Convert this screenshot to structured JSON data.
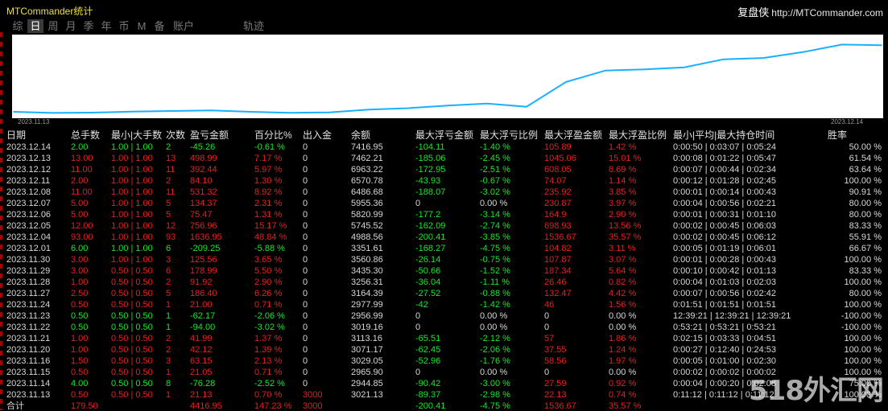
{
  "app_title": "MTCommander统计",
  "brand": "复盘侠",
  "site_url": "http://MTCommander.com",
  "tabs": [
    {
      "label": "综",
      "active": false
    },
    {
      "label": "日",
      "active": true
    },
    {
      "label": "周",
      "active": false
    },
    {
      "label": "月",
      "active": false
    },
    {
      "label": "季",
      "active": false
    },
    {
      "label": "年",
      "active": false
    },
    {
      "label": "币",
      "active": false
    },
    {
      "label": "M",
      "active": false
    },
    {
      "label": "备",
      "active": false
    },
    {
      "label": "账户",
      "active": false
    },
    {
      "label": "轨迹",
      "active": false
    }
  ],
  "chart_data": {
    "type": "line",
    "series_color": "#1ab0ff",
    "x_start_label": "2023.11.13",
    "x_end_label": "2023.12.14",
    "x": [
      "2023.11.13",
      "2023.11.14",
      "2023.11.15",
      "2023.11.16",
      "2023.11.20",
      "2023.11.21",
      "2023.11.22",
      "2023.11.23",
      "2023.11.24",
      "2023.11.27",
      "2023.11.28",
      "2023.11.29",
      "2023.11.30",
      "2023.12.01",
      "2023.12.04",
      "2023.12.05",
      "2023.12.06",
      "2023.12.07",
      "2023.12.08",
      "2023.12.11",
      "2023.12.12",
      "2023.12.13",
      "2023.12.14"
    ],
    "y": [
      3021.13,
      2944.85,
      2965.9,
      3029.05,
      3071.17,
      3113.16,
      3019.16,
      2956.99,
      2977.99,
      3164.39,
      3256.31,
      3435.3,
      3560.86,
      3351.61,
      4988.56,
      5745.52,
      5820.99,
      5955.36,
      6486.68,
      6570.78,
      6963.22,
      7462.21,
      7416.95
    ]
  },
  "columns": [
    "日期",
    "总手数",
    "最小|大手数",
    "次数",
    "盈亏金额",
    "百分比%",
    "出入金",
    "余额",
    "最大浮亏金额",
    "最大浮亏比例",
    "最大浮盈金额",
    "最大浮盈比例",
    "最小|平均|最大持仓时间",
    "胜率"
  ],
  "rows": [
    [
      "2023.12.14",
      "2.00",
      "1.00 | 1.00",
      "2",
      "-45.26",
      "-0.61 %",
      "0",
      "7416.95",
      "-104.11",
      "-1.40 %",
      "105.89",
      "1.42 %",
      "0:00:50 | 0:03:07 | 0:05:24",
      "50.00 %"
    ],
    [
      "2023.12.13",
      "13.00",
      "1.00 | 1.00",
      "13",
      "498.99",
      "7.17 %",
      "0",
      "7462.21",
      "-185.06",
      "-2.45 %",
      "1045.06",
      "15.01 %",
      "0:00:08 | 0:01:22 | 0:05:47",
      "61.54 %"
    ],
    [
      "2023.12.12",
      "11.00",
      "1.00 | 1.00",
      "11",
      "392.44",
      "5.97 %",
      "0",
      "6963.22",
      "-172.95",
      "-2.51 %",
      "608.05",
      "8.69 %",
      "0:00:07 | 0:00:44 | 0:02:34",
      "63.64 %"
    ],
    [
      "2023.12.11",
      "2.00",
      "1.00 | 1.00",
      "2",
      "84.10",
      "1.30 %",
      "0",
      "6570.78",
      "-43.93",
      "-0.67 %",
      "74.07",
      "1.14 %",
      "0:00:12 | 0:01:28 | 0:02:45",
      "100.00 %"
    ],
    [
      "2023.12.08",
      "11.00",
      "1.00 | 1.00",
      "11",
      "531.32",
      "8.92 %",
      "0",
      "6486.68",
      "-188.07",
      "-3.02 %",
      "235.92",
      "3.85 %",
      "0:00:01 | 0:00:14 | 0:00:43",
      "90.91 %"
    ],
    [
      "2023.12.07",
      "5.00",
      "1.00 | 1.00",
      "5",
      "134.37",
      "2.31 %",
      "0",
      "5955.36",
      "0",
      "0.00 %",
      "230.87",
      "3.97 %",
      "0:00:04 | 0:00:56 | 0:02:21",
      "80.00 %"
    ],
    [
      "2023.12.06",
      "5.00",
      "1.00 | 1.00",
      "5",
      "75.47",
      "1.31 %",
      "0",
      "5820.99",
      "-177.2",
      "-3.14 %",
      "164.9",
      "2.90 %",
      "0:00:01 | 0:00:31 | 0:01:10",
      "80.00 %"
    ],
    [
      "2023.12.05",
      "12.00",
      "1.00 | 1.00",
      "12",
      "756.96",
      "15.17 %",
      "0",
      "5745.52",
      "-162.09",
      "-2.74 %",
      "698.93",
      "13.56 %",
      "0:00:02 | 0:00:45 | 0:06:03",
      "83.33 %"
    ],
    [
      "2023.12.04",
      "93.00",
      "1.00 | 1.00",
      "93",
      "1636.95",
      "48.84 %",
      "0",
      "4988.56",
      "-200.41",
      "-3.85 %",
      "1536.67",
      "35.57 %",
      "0:00:02 | 0:00:45 | 0:06:12",
      "55.91 %"
    ],
    [
      "2023.12.01",
      "6.00",
      "1.00 | 1.00",
      "6",
      "-209.25",
      "-5.88 %",
      "0",
      "3351.61",
      "-168.27",
      "-4.75 %",
      "104.82",
      "3.11 %",
      "0:00:05 | 0:01:19 | 0:06:01",
      "66.67 %"
    ],
    [
      "2023.11.30",
      "3.00",
      "1.00 | 1.00",
      "3",
      "125.56",
      "3.65 %",
      "0",
      "3560.86",
      "-26.14",
      "-0.75 %",
      "107.87",
      "3.07 %",
      "0:00:01 | 0:00:28 | 0:00:43",
      "100.00 %"
    ],
    [
      "2023.11.29",
      "3.00",
      "0.50 | 0.50",
      "6",
      "178.99",
      "5.50 %",
      "0",
      "3435.30",
      "-50.66",
      "-1.52 %",
      "187.34",
      "5.64 %",
      "0:00:10 | 0:00:42 | 0:01:13",
      "83.33 %"
    ],
    [
      "2023.11.28",
      "1.00",
      "0.50 | 0.50",
      "2",
      "91.92",
      "2.90 %",
      "0",
      "3256.31",
      "-36.04",
      "-1.11 %",
      "26.46",
      "0.82 %",
      "0:00:04 | 0:01:03 | 0:02:03",
      "100.00 %"
    ],
    [
      "2023.11.27",
      "2.50",
      "0.50 | 0.50",
      "5",
      "186.40",
      "6.26 %",
      "0",
      "3164.39",
      "-27.52",
      "-0.88 %",
      "132.47",
      "4.42 %",
      "0:00:07 | 0:00:56 | 0:02:42",
      "80.00 %"
    ],
    [
      "2023.11.24",
      "0.50",
      "0.50 | 0.50",
      "1",
      "21.00",
      "0.71 %",
      "0",
      "2977.99",
      "-42",
      "-1.42 %",
      "46",
      "1.56 %",
      "0:01:51 | 0:01:51 | 0:01:51",
      "100.00 %"
    ],
    [
      "2023.11.23",
      "0.50",
      "0.50 | 0.50",
      "1",
      "-62.17",
      "-2.06 %",
      "0",
      "2956.99",
      "0",
      "0.00 %",
      "0",
      "0.00 %",
      "12:39:21 | 12:39:21 | 12:39:21",
      "-100.00 %"
    ],
    [
      "2023.11.22",
      "0.50",
      "0.50 | 0.50",
      "1",
      "-94.00",
      "-3.02 %",
      "0",
      "3019.16",
      "0",
      "0.00 %",
      "0",
      "0.00 %",
      "0:53:21 | 0:53:21 | 0:53:21",
      "-100.00 %"
    ],
    [
      "2023.11.21",
      "1.00",
      "0.50 | 0.50",
      "2",
      "41.99",
      "1.37 %",
      "0",
      "3113.16",
      "-65.51",
      "-2.12 %",
      "57",
      "1.86 %",
      "0:02:15 | 0:03:33 | 0:04:51",
      "100.00 %"
    ],
    [
      "2023.11.20",
      "1.00",
      "0.50 | 0.50",
      "2",
      "42.12",
      "1.39 %",
      "0",
      "3071.17",
      "-62.45",
      "-2.06 %",
      "37.55",
      "1.24 %",
      "0:00:27 | 0:12:40 | 0:24:53",
      "100.00 %"
    ],
    [
      "2023.11.16",
      "1.50",
      "0.50 | 0.50",
      "3",
      "63.15",
      "2.13 %",
      "0",
      "3029.05",
      "-52.96",
      "-1.76 %",
      "58.56",
      "1.97 %",
      "0:00:05 | 0:01:00 | 0:02:30",
      "100.00 %"
    ],
    [
      "2023.11.15",
      "0.50",
      "0.50 | 0.50",
      "1",
      "21.05",
      "0.71 %",
      "0",
      "2965.90",
      "0",
      "0.00 %",
      "0",
      "0.00 %",
      "0:00:02 | 0:00:02 | 0:00:02",
      "100.00 %"
    ],
    [
      "2023.11.14",
      "4.00",
      "0.50 | 0.50",
      "8",
      "-76.28",
      "-2.52 %",
      "0",
      "2944.85",
      "-90.42",
      "-3.00 %",
      "27.59",
      "0.92 %",
      "0:00:04 | 0:00:20 | 0:02:08",
      "75.00 %"
    ],
    [
      "2023.11.13",
      "0.50",
      "0.50 | 0.50",
      "1",
      "21.13",
      "0.70 %",
      "3000",
      "3021.13",
      "-89.37",
      "-2.98 %",
      "22.13",
      "0.74 %",
      "0:11:12 | 0:11:12 | 0:11:12",
      "100.00 %"
    ]
  ],
  "total_row": [
    "合计",
    "179.50",
    "",
    "",
    "4416.95",
    "147.23 %",
    "3000",
    "",
    "-200.41",
    "-4.75 %",
    "1536.67",
    "35.57 %",
    "",
    ""
  ],
  "colors": {
    "gain": "#e62020",
    "loss": "#19e62b",
    "line": "#1ab0ff"
  },
  "watermark": "518外汇网"
}
